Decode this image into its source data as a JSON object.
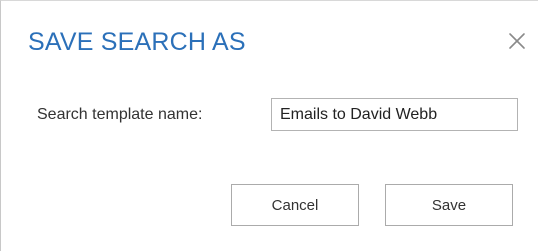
{
  "dialog": {
    "title": "SAVE SEARCH AS",
    "close_icon": "close-icon",
    "field": {
      "label": "Search template name:",
      "value": "Emails to David Webb"
    },
    "buttons": {
      "cancel_label": "Cancel",
      "save_label": "Save"
    }
  },
  "colors": {
    "title": "#2b70b9",
    "text": "#333333",
    "border": "#ababab",
    "close_icon": "#8a8a8a"
  }
}
